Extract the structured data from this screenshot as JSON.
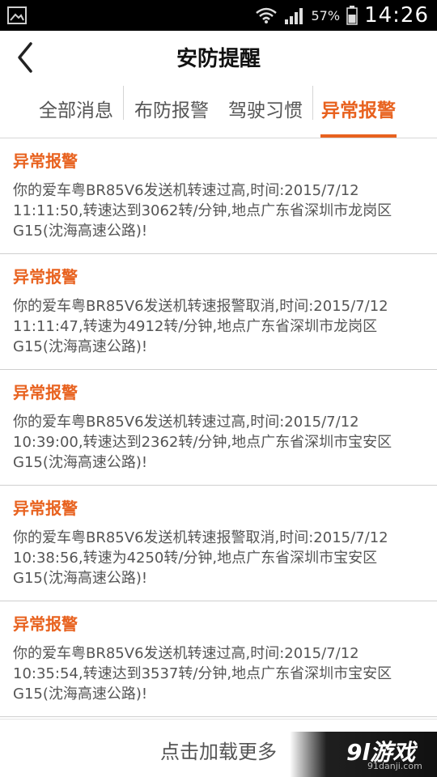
{
  "status_bar": {
    "battery_percent": "57%",
    "time": "14:26",
    "icons": [
      "image-icon",
      "wifi-icon",
      "signal-icon",
      "battery-icon"
    ]
  },
  "header": {
    "title": "安防提醒",
    "back_icon": "chevron-left-icon"
  },
  "tabs": [
    {
      "label": "全部消息",
      "active": false
    },
    {
      "label": "布防报警",
      "active": false
    },
    {
      "label": "驾驶习惯",
      "active": false
    },
    {
      "label": "异常报警",
      "active": true
    }
  ],
  "accent_color": "#e8621f",
  "alerts": [
    {
      "title": "异常报警",
      "body": "你的爱车粤BR85V6发送机转速过高,时间:2015/7/12 11:11:50,转速达到3062转/分钟,地点广东省深圳市龙岗区G15(沈海高速公路)!"
    },
    {
      "title": "异常报警",
      "body": "你的爱车粤BR85V6发送机转速报警取消,时间:2015/7/12 11:11:47,转速为4912转/分钟,地点广东省深圳市龙岗区G15(沈海高速公路)!"
    },
    {
      "title": "异常报警",
      "body": "你的爱车粤BR85V6发送机转速过高,时间:2015/7/12 10:39:00,转速达到2362转/分钟,地点广东省深圳市宝安区G15(沈海高速公路)!"
    },
    {
      "title": "异常报警",
      "body": "你的爱车粤BR85V6发送机转速报警取消,时间:2015/7/12 10:38:56,转速为4250转/分钟,地点广东省深圳市宝安区G15(沈海高速公路)!"
    },
    {
      "title": "异常报警",
      "body": "你的爱车粤BR85V6发送机转速过高,时间:2015/7/12 10:35:54,转速达到3537转/分钟,地点广东省深圳市宝安区G15(沈海高速公路)!"
    }
  ],
  "load_more_label": "点击加载更多",
  "watermark": {
    "logo": "9l游戏",
    "site": "91danji.com"
  }
}
